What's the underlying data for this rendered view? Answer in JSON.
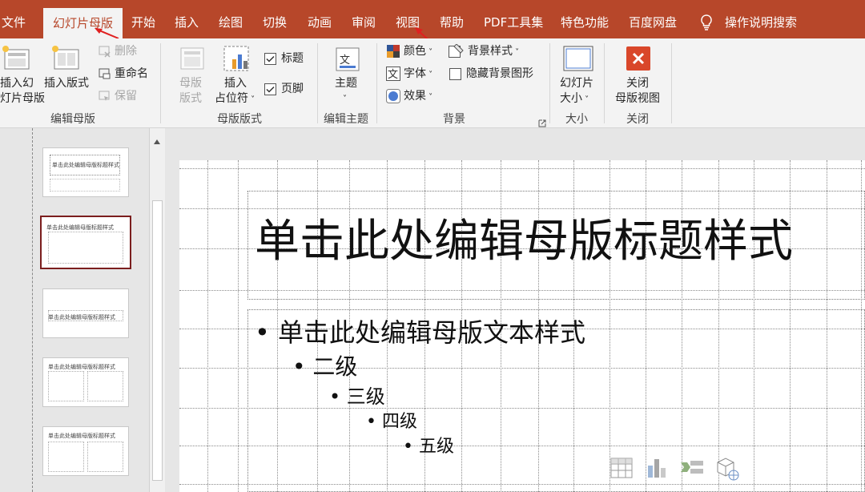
{
  "menu": {
    "tabs": [
      "文件",
      "幻灯片母版",
      "开始",
      "插入",
      "绘图",
      "切换",
      "动画",
      "审阅",
      "视图",
      "帮助",
      "PDF工具集",
      "特色功能",
      "百度网盘",
      "操作说明搜索"
    ]
  },
  "ribbon": {
    "edit_master": {
      "insert_slide_master": [
        "插入幻",
        "灯片母版"
      ],
      "insert_layout": "插入版式",
      "delete": "删除",
      "rename": "重命名",
      "preserve": "保留",
      "label": "编辑母版"
    },
    "master_layout": {
      "master_layout_btn": [
        "母版",
        "版式"
      ],
      "insert_placeholder": [
        "插入",
        "占位符"
      ],
      "title_check": "标题",
      "footer_check": "页脚",
      "label": "母版版式"
    },
    "edit_theme": {
      "theme": "主题",
      "label": "编辑主题"
    },
    "background": {
      "colors": "颜色",
      "fonts": "字体",
      "effects": "效果",
      "background_styles": "背景样式",
      "hide_bg_graphics": "隐藏背景图形",
      "label": "背景"
    },
    "size": {
      "slide_size": [
        "幻灯片",
        "大小"
      ],
      "label": "大小"
    },
    "close": {
      "close_master": [
        "关闭",
        "母版视图"
      ],
      "label": "关闭"
    }
  },
  "thumbnails": [
    {
      "title": "单击此处编辑母版标题样式"
    },
    {
      "title": "单击此处编辑母版标题样式"
    },
    {
      "title": "单击此处编辑母版标题样式"
    },
    {
      "title": "单击此处编辑母版标题样式"
    },
    {
      "title": "单击此处编辑母版标题样式"
    }
  ],
  "slide": {
    "title": "单击此处编辑母版标题样式",
    "levels": [
      "单击此处编辑母版文本样式",
      "二级",
      "三级",
      "四级",
      "五级"
    ]
  },
  "colors": {
    "brand": "#b7472a",
    "ribbon_bg": "#f3f3f3",
    "selected_thumb": "#7b1e1e",
    "annotation_arrow": "#e02020"
  }
}
